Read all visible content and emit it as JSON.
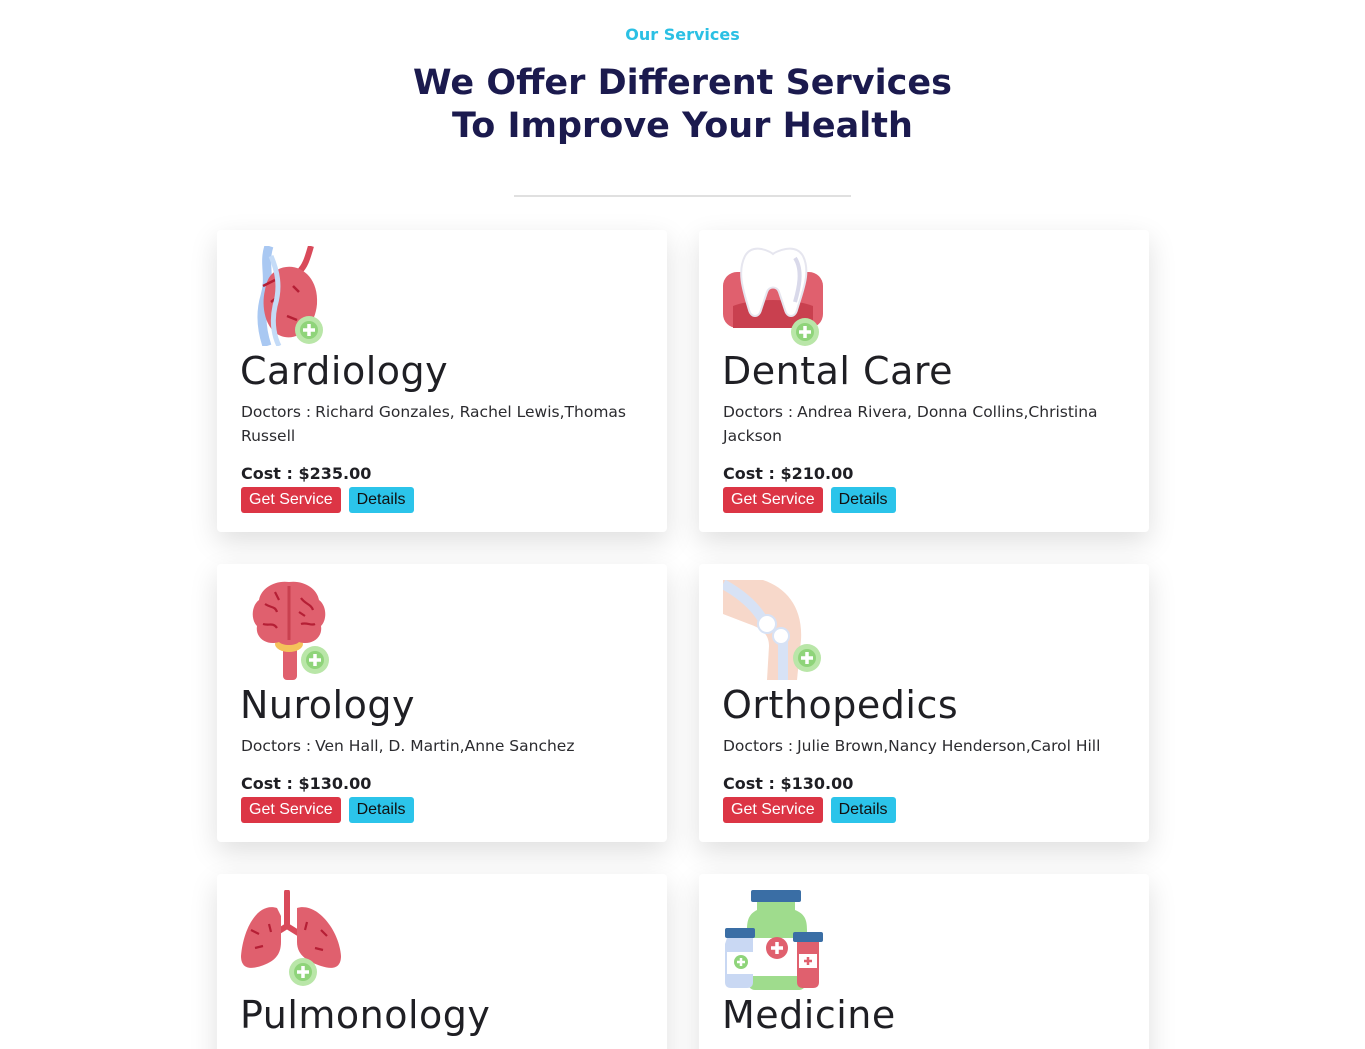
{
  "section": {
    "eyebrow": "Our Services",
    "headline_line1": "We Offer Different Services",
    "headline_line2": "To Improve Your Health"
  },
  "labels": {
    "doctors": "Doctors :",
    "cost": "Cost :",
    "get_service": "Get Service",
    "details": "Details"
  },
  "services": [
    {
      "name": "Cardiology",
      "icon": "heart-icon",
      "doctors": "Richard Gonzales, Rachel Lewis,Thomas Russell",
      "cost": "$235.00"
    },
    {
      "name": "Dental Care",
      "icon": "tooth-icon",
      "doctors": "Andrea Rivera, Donna Collins,Christina Jackson",
      "cost": "$210.00"
    },
    {
      "name": "Nurology",
      "icon": "brain-icon",
      "doctors": "Ven Hall, D. Martin,Anne Sanchez",
      "cost": "$130.00"
    },
    {
      "name": "Orthopedics",
      "icon": "knee-joint-icon",
      "doctors": "Julie Brown,Nancy Henderson,Carol Hill",
      "cost": "$130.00"
    },
    {
      "name": "Pulmonology",
      "icon": "lungs-icon"
    },
    {
      "name": "Medicine",
      "icon": "medicine-bottles-icon"
    }
  ],
  "colors": {
    "accent": "#2bc0e4",
    "heading": "#1b1a4e",
    "danger": "#dc3545",
    "info": "#2bc4ea"
  }
}
